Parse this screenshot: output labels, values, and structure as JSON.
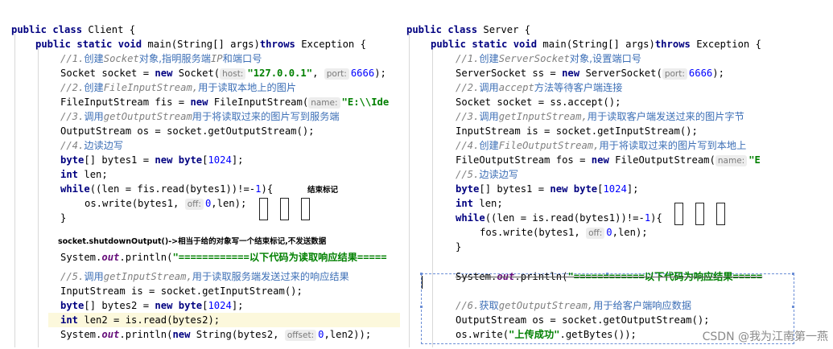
{
  "client": {
    "lines": [
      "public class Client {",
      "public static void main(String[] args)throws Exception {",
      "//1.创建Socket对象,指明服务端IP和端口号",
      "Socket socket = new Socket(host: \"127.0.0.1\", port: 6666);",
      "//2.创建FileInputStream,用于读取本地上的图片",
      "FileInputStream fis = new FileInputStream(name: \"E:\\\\Ide",
      "//3.调用getOutputStream用于将读取过来的图片写到服务端",
      "OutputStream os = socket.getOutputStream();",
      "//4.边读边写",
      "byte[] bytes1 = new byte[1024];",
      "int len;",
      "while((len = fis.read(bytes1))!=-1){",
      "os.write(bytes1, off: 0,len);",
      "}",
      "System.out.println(\"============以下代码为读取响应结果=====",
      "//5.调用getInputStream,用于读取服务端发送过来的响应结果",
      "InputStream is = socket.getInputStream();",
      "byte[] bytes2 = new byte[1024];",
      "int len2 = is.read(bytes2);",
      "System.out.println(new String(bytes2, offset: 0,len2));"
    ],
    "note_end_marker": "结束标记",
    "note_shutdown": "socket.shutdownOutput()->相当于给的对象写一个结束标记,不发送数据"
  },
  "server": {
    "lines": [
      "public class Server {",
      "public static void main(String[] args)throws Exception {",
      "//1.创建ServerSocket对象,设置端口号",
      "ServerSocket ss = new ServerSocket(port: 6666);",
      "//2.调用accept方法等待客户端连接",
      "Socket socket = ss.accept();",
      "//3.调用getInputStream,用于读取客户端发送过来的图片字节",
      "InputStream is = socket.getInputStream();",
      "//4.创建FileOutputStream,用于将读取过来的图片写到本地上",
      "FileOutputStream fos = new FileOutputStream(name: \"E",
      "//5.边读边写",
      "byte[] bytes1 = new byte[1024];",
      "int len;",
      "while((len = is.read(bytes1))!=-1){",
      "fos.write(bytes1, off: 0,len);",
      "}",
      "System.out.println(\"============以下代码为响应结果=====",
      "//6.获取getOutputStream,用于给客户端响应数据",
      "OutputStream os = socket.getOutputStream();",
      "os.write(\"上传成功\".getBytes());"
    ]
  },
  "watermark": "CSDN @我为江南第一燕"
}
